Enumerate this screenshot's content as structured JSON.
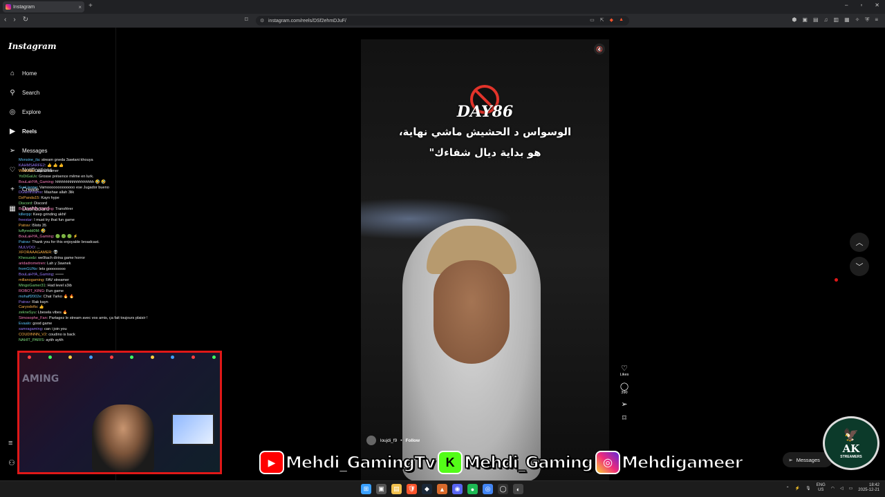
{
  "browser": {
    "tab_title": "Instagram",
    "tab_close": "×",
    "new_tab": "+",
    "url": "instagram.com/reels/DSf2ehmDJuF/",
    "window_controls": [
      "–",
      "▫",
      "✕"
    ]
  },
  "sidebar": {
    "brand": "Instagram",
    "items": [
      {
        "label": "Home",
        "icon": "⌂"
      },
      {
        "label": "Search",
        "icon": "⚲"
      },
      {
        "label": "Explore",
        "icon": "◎"
      },
      {
        "label": "Reels",
        "icon": "▶"
      },
      {
        "label": "Messages",
        "icon": "➢"
      },
      {
        "label": "Notifications",
        "icon": "♡"
      },
      {
        "label": "Create",
        "icon": "+"
      },
      {
        "label": "Dashboard",
        "icon": "▦"
      }
    ],
    "more_icon": "≡",
    "meta_icon": "⚇"
  },
  "chat": [
    {
      "user": "Monsine_ila",
      "text": "stream gneda 3awtani khouya"
    },
    {
      "user": "KAHMSARFE2",
      "text": "👍 👍 👍"
    },
    {
      "user": "WadoHar",
      "text": "top streamer"
    },
    {
      "user": "YoDiGaUs",
      "text": "Grosse présence même en lurk."
    },
    {
      "user": "BouLaHYA_Gaming",
      "text": "hhhhhhhhhhhhhhhhhh 🤣 🤣"
    },
    {
      "user": "SueLleone",
      "text": "Vamooooooooooooo ese Jugador bueno"
    },
    {
      "user": "DGwnthzamo",
      "text": "Mashae allah 3lik"
    },
    {
      "user": "DzPanda15",
      "text": "Kayn hype"
    },
    {
      "user": "Discord",
      "text": "Discord"
    },
    {
      "user": "BouLaHYA_Gaming",
      "text": "Transférer"
    },
    {
      "user": "killerpp",
      "text": "Keep grinding akhi!"
    },
    {
      "user": "freestar",
      "text": "I must try that fun game"
    },
    {
      "user": "Patrav",
      "text": "l5lots 35"
    },
    {
      "user": "luffyredd0M",
      "text": "🤣"
    },
    {
      "user": "BouLaHYA_Gaming",
      "text": "🟢 🟢 🟢 ⚡"
    },
    {
      "user": "Patrav",
      "text": "Thank you for this enjoyable broadcast."
    },
    {
      "user": "NULVOO",
      "text": "..."
    },
    {
      "user": "XFORAAAGAMER",
      "text": "👽"
    },
    {
      "user": "Khesuodz",
      "text": "we9tach dirina game horror"
    },
    {
      "user": "aridadrometren",
      "text": "Lah y 3awnek"
    },
    {
      "user": "fromGUNv",
      "text": "lets goooooooo"
    },
    {
      "user": "BouLaHYA_Gaming",
      "text": "▫▫▫▫▫▫"
    },
    {
      "user": "millanogaming",
      "text": "FAV streamer"
    },
    {
      "user": "MingoGamer31",
      "text": "Had level s3ib"
    },
    {
      "user": "ROBOT_KING",
      "text": "Fun game"
    },
    {
      "user": "mohaff2002e",
      "text": "Chat 7arko 🔥 🔥"
    },
    {
      "user": "Patrav",
      "text": "Rak kayn"
    },
    {
      "user": "Caryodofis",
      "text": "👍"
    },
    {
      "user": "zekneSyu",
      "text": "Lbesela vibes 🔥"
    },
    {
      "user": "Simosophe_Fan",
      "text": "Partagez le stream avec vos amis, ça fait toujours plaisir !"
    },
    {
      "user": "Evaalo",
      "text": "good game"
    },
    {
      "user": "samragaming",
      "text": "can i join you"
    },
    {
      "user": "COUDINNN_V2",
      "text": "coudino is back"
    },
    {
      "user": "NAHIT_PARIS",
      "text": "aytih aytih"
    }
  ],
  "reel": {
    "day_title": "DAY86",
    "arabic_line1": "الوسواس د الحشيش ماشي نهاية،",
    "arabic_line2": "هو بداية ديال شفاءك\"",
    "author": "loujdi_f9",
    "follow": "Follow",
    "dot": "•",
    "mute_icon": "🔇",
    "likes_label": "Likes",
    "comments_count": "390",
    "like_icon": "♡",
    "comment_icon": "◯",
    "share_icon": "➢",
    "save_icon": "⌑",
    "more_icon": "···"
  },
  "scroll": {
    "up": "︿",
    "down": "﹀"
  },
  "messages_button": {
    "label": "Messages",
    "icon": "➢"
  },
  "overlay": {
    "youtube": "Mehdi_GamingTv",
    "kick": "Mehdi_Gaming",
    "instagram": "Mehdigameer",
    "youtube_icon": "▶",
    "kick_icon": "K",
    "instagram_icon": "◎",
    "logo_main": "AK",
    "logo_sub": "STREAMERS",
    "logo_icon": "🦅",
    "webcam_neon": "AMING"
  },
  "taskbar": {
    "lang_top": "ENG",
    "lang_bottom": "US",
    "time": "18:42",
    "date": "2025-12-21",
    "icons": [
      "⊞",
      "▣",
      "▤",
      "🛡",
      "◆",
      "▲",
      "◉",
      "●",
      "◎",
      "◯",
      "◐"
    ]
  },
  "colors": {
    "accent_red": "#e01818",
    "kick_green": "#53fc18",
    "youtube_red": "#ff0000",
    "brave_orange": "#fb542b"
  }
}
